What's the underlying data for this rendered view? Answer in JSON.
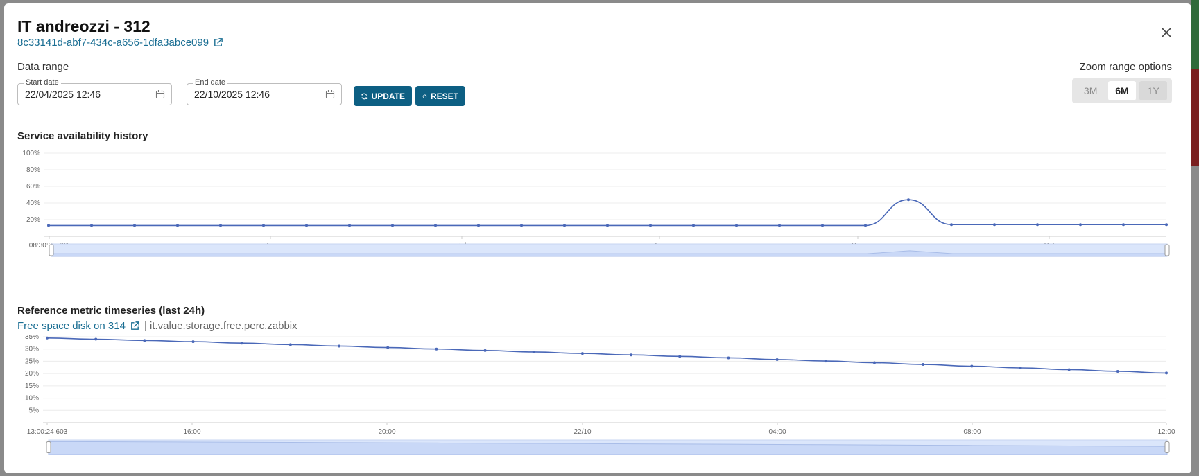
{
  "modal": {
    "title": "IT andreozzi - 312",
    "uuid": "8c33141d-abf7-434c-a656-1dfa3abce099"
  },
  "date_range": {
    "label": "Data range",
    "start_label": "Start date",
    "start_value": "22/04/2025 12:46",
    "end_label": "End date",
    "end_value": "22/10/2025 12:46",
    "update_label": "UPDATE",
    "reset_label": "RESET"
  },
  "zoom": {
    "label": "Zoom range options",
    "options": [
      "3M",
      "6M",
      "1Y"
    ],
    "selected": "6M"
  },
  "availability": {
    "title": "Service availability history"
  },
  "reference": {
    "title": "Reference metric timeseries (last 24h)",
    "metric_link": "Free space disk on 314",
    "metric_id": "| it.value.storage.free.perc.zabbix"
  },
  "colors": {
    "accent": "#0d5f83",
    "link": "#1a6e93",
    "series": "#4a68b8",
    "navigator_fill": "#dbe6fb"
  },
  "icons": [
    "external-link-icon",
    "close-icon",
    "calendar-icon",
    "refresh-icon",
    "reset-icon"
  ],
  "chart_data": [
    {
      "type": "line",
      "title": "Service availability history",
      "x_ticks": [
        "08:30:05 701",
        "Jun",
        "Jul",
        "Aug",
        "Sep",
        "Oct"
      ],
      "y_ticks": [
        "20%",
        "40%",
        "60%",
        "80%",
        "100%"
      ],
      "ylim": [
        0,
        100
      ],
      "grid": true,
      "series": [
        {
          "values": [
            13,
            13,
            13,
            13,
            13,
            13,
            13,
            13,
            13,
            13,
            13,
            13,
            13,
            13,
            13,
            13,
            13,
            13,
            13,
            13,
            44,
            14,
            14,
            14,
            14,
            14,
            14
          ]
        }
      ],
      "navigator": true
    },
    {
      "type": "line",
      "title": "Reference metric timeseries (last 24h)",
      "x_ticks": [
        "13:00:24 603",
        "16:00",
        "20:00",
        "22/10",
        "04:00",
        "08:00",
        "12:00"
      ],
      "y_ticks": [
        "5%",
        "10%",
        "15%",
        "20%",
        "25%",
        "30%",
        "35%"
      ],
      "ylim": [
        0,
        35
      ],
      "grid": true,
      "series": [
        {
          "values": [
            34.5,
            34.0,
            33.5,
            33.0,
            32.4,
            31.8,
            31.2,
            30.6,
            30.0,
            29.4,
            28.8,
            28.2,
            27.6,
            27.0,
            26.4,
            25.7,
            25.1,
            24.4,
            23.7,
            23.0,
            22.3,
            21.6,
            20.9,
            20.2
          ]
        }
      ],
      "navigator": true
    }
  ]
}
